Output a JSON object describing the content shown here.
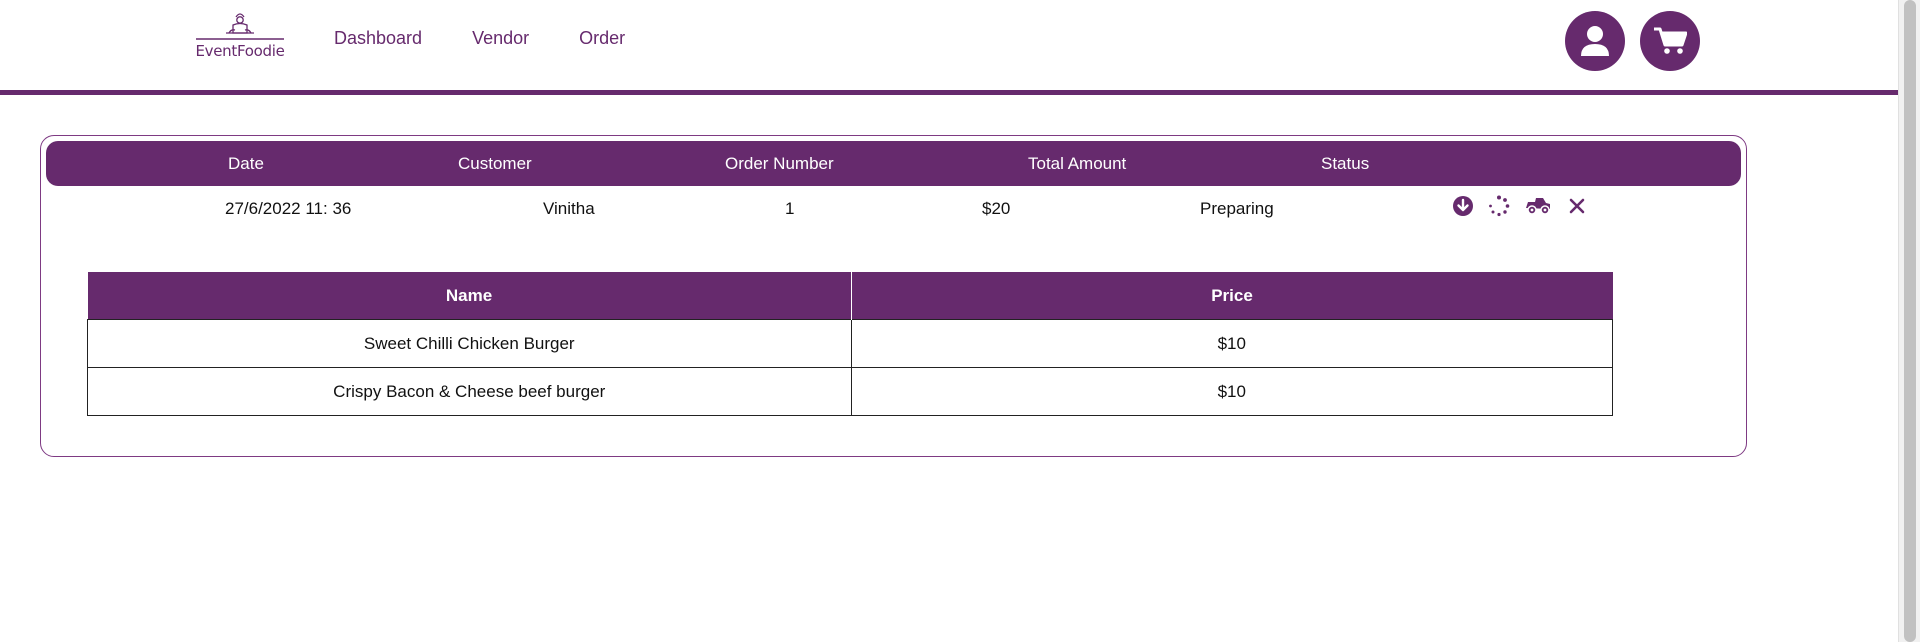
{
  "brand": {
    "name": "EventFoodie",
    "primary_color": "#662a6d"
  },
  "nav": {
    "items": [
      {
        "label": "Dashboard"
      },
      {
        "label": "Vendor"
      },
      {
        "label": "Order"
      }
    ]
  },
  "header_icons": {
    "user": "user-icon",
    "cart": "cart-icon"
  },
  "order": {
    "columns": {
      "date": "Date",
      "customer": "Customer",
      "order_number": "Order Number",
      "total_amount": "Total Amount",
      "status": "Status"
    },
    "row": {
      "date": "27/6/2022 11: 36",
      "customer": "Vinitha",
      "order_number": "1",
      "total_amount": "$20",
      "status": "Preparing"
    },
    "actions": [
      "arrow-circle-down-icon",
      "spinner-icon",
      "delivery-truck-icon",
      "close-icon"
    ],
    "items_table": {
      "headers": {
        "name": "Name",
        "price": "Price"
      },
      "rows": [
        {
          "name": "Sweet Chilli Chicken Burger",
          "price": "$10"
        },
        {
          "name": "Crispy Bacon & Cheese beef burger",
          "price": "$10"
        }
      ]
    }
  }
}
